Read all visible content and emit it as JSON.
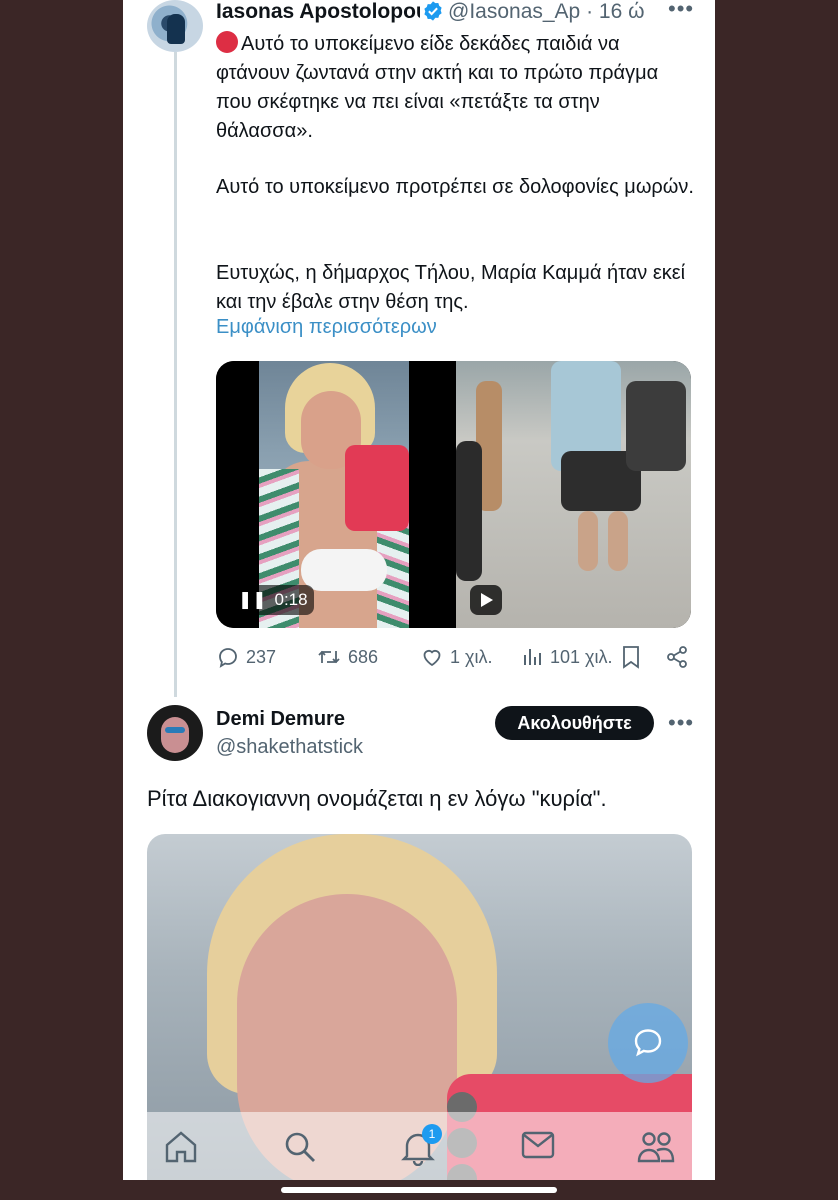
{
  "tweet1": {
    "author_name": "Iasonas Apostolopoυ",
    "handle": "@Iasonas_Ap",
    "time": "· 16 ώ",
    "paragraphs": [
      "Αυτό το υποκείμενο είδε δεκάδες παιδιά να φτάνουν ζωντανά στην ακτή και το πρώτο πράγμα που σκέφτηκε να πει είναι «πετάξτε τα στην θάλασσα».",
      "Αυτό το υποκείμενο προτρέπει σε δολοφονίες μωρών.",
      "Ευτυχώς, η δήμαρχος Τήλου, Μαρία Καμμά ήταν εκεί και την έβαλε στην θέση της."
    ],
    "show_more": "Εμφάνιση περισσότερων",
    "video_duration": "0:18",
    "stats": {
      "replies": "237",
      "retweets": "686",
      "likes": "1 χιλ.",
      "views": "101 χιλ."
    }
  },
  "tweet2": {
    "author_name": "Demi Demure",
    "handle": "@shakethatstick",
    "follow_label": "Ακολουθήστε",
    "text": "Ρίτα Διακογιαννη ονομάζεται η εν λόγω \"κυρία\"."
  },
  "tabbar": {
    "items": [
      "home-icon",
      "search-icon",
      "bell-icon",
      "mail-icon",
      "communities-icon"
    ],
    "notification_count": "1"
  },
  "colors": {
    "accent": "#1d9bf0",
    "text": "#0f1419",
    "muted": "#536471",
    "background_outer": "#3b2626"
  }
}
